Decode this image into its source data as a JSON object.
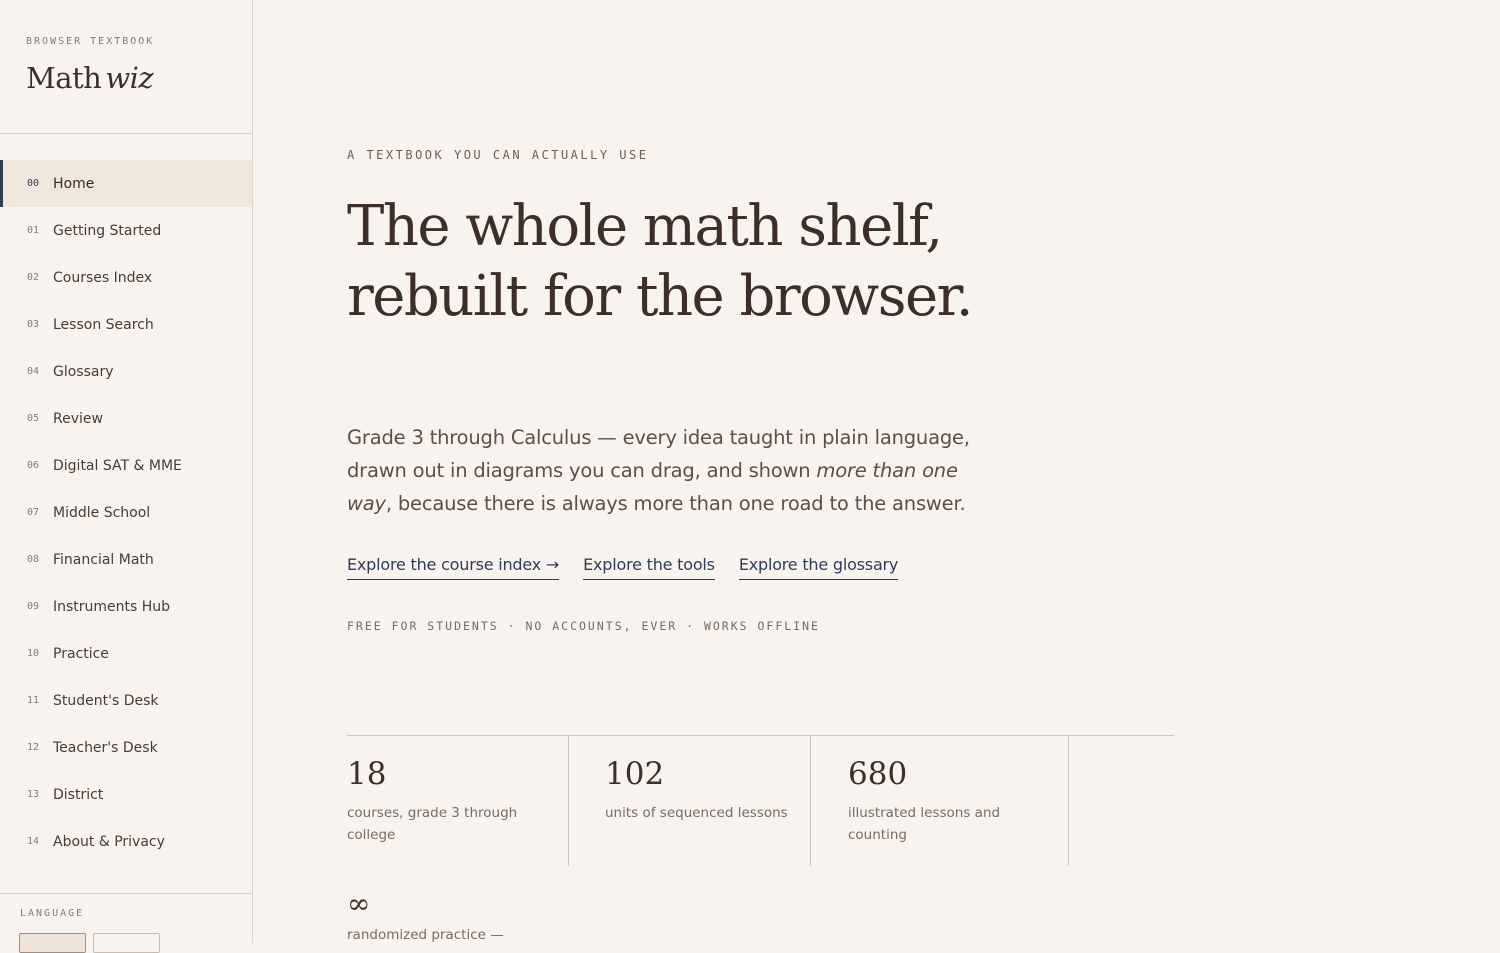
{
  "sidebar": {
    "eyebrow": "BROWSER TEXTBOOK",
    "logo_main": "Math",
    "logo_italic": "wiz",
    "items": [
      {
        "num": "00",
        "label": "Home",
        "active": true
      },
      {
        "num": "01",
        "label": "Getting Started"
      },
      {
        "num": "02",
        "label": "Courses Index"
      },
      {
        "num": "03",
        "label": "Lesson Search"
      },
      {
        "num": "04",
        "label": "Glossary"
      },
      {
        "num": "05",
        "label": "Review"
      },
      {
        "num": "06",
        "label": "Digital SAT & MME"
      },
      {
        "num": "07",
        "label": "Middle School"
      },
      {
        "num": "08",
        "label": "Financial Math"
      },
      {
        "num": "09",
        "label": "Instruments Hub"
      },
      {
        "num": "10",
        "label": "Practice"
      },
      {
        "num": "11",
        "label": "Student's Desk"
      },
      {
        "num": "12",
        "label": "Teacher's Desk"
      },
      {
        "num": "13",
        "label": "District"
      },
      {
        "num": "14",
        "label": "About & Privacy"
      }
    ],
    "language_label": "LANGUAGE"
  },
  "hero": {
    "kicker": "A TEXTBOOK YOU CAN ACTUALLY USE",
    "title": "The whole math shelf, rebuilt for the browser.",
    "lede_start": "Grade 3 through Calculus — every idea taught in plain language, drawn out in diagrams you can drag, and shown ",
    "lede_em": "more than one way",
    "lede_end": ", because there is always more than one road to the answer.",
    "links": {
      "course_index": "Explore the course index →",
      "tools": "Explore the tools",
      "glossary": "Explore the glossary"
    },
    "tagline": "FREE FOR STUDENTS · NO ACCOUNTS, EVER · WORKS OFFLINE"
  },
  "stats": [
    {
      "value": "18",
      "desc": "courses, grade 3 through college"
    },
    {
      "value": "102",
      "desc": "units of sequenced lessons"
    },
    {
      "value": "680",
      "desc": "illustrated lessons and counting"
    },
    {
      "value": "∞",
      "desc": "randomized practice —"
    }
  ],
  "colors": {
    "background": "#f8f3ef",
    "text": "#4a3b31",
    "accent": "#2e3d57",
    "active_bg": "#f0e6db"
  }
}
